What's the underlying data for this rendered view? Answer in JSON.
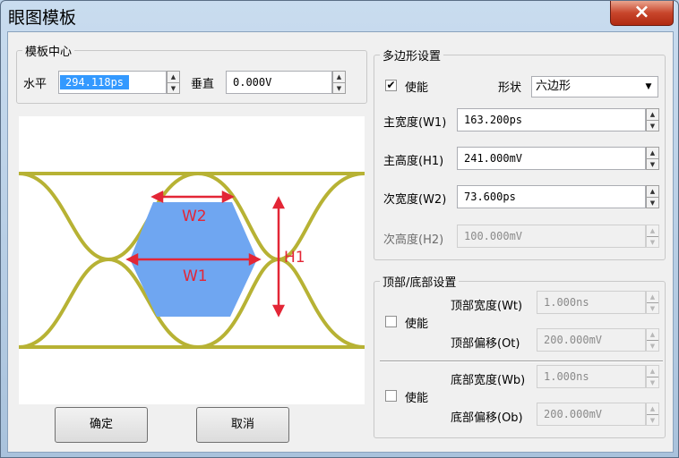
{
  "window": {
    "title": "眼图模板",
    "close_icon": "×"
  },
  "template_center": {
    "legend": "模板中心",
    "horizontal_label": "水平",
    "horizontal_value": "294.118ps",
    "vertical_label": "垂直",
    "vertical_value": "0.000V"
  },
  "diagram": {
    "label_w1": "W1",
    "label_w2": "W2",
    "label_h1": "H1",
    "colors": {
      "eye": "#b7b234",
      "polygon": "#6fa6f1",
      "marker": "#e32636"
    }
  },
  "buttons": {
    "ok": "确定",
    "cancel": "取消"
  },
  "polygon_settings": {
    "legend": "多边形设置",
    "enable_label": "使能",
    "enabled": true,
    "shape_label": "形状",
    "shape_value": "六边形",
    "main_width_label": "主宽度(W1)",
    "main_width_value": "163.200ps",
    "main_height_label": "主高度(H1)",
    "main_height_value": "241.000mV",
    "sub_width_label": "次宽度(W2)",
    "sub_width_value": "73.600ps",
    "sub_height_label": "次高度(H2)",
    "sub_height_value": "100.000mV"
  },
  "top_bottom_settings": {
    "legend": "顶部/底部设置",
    "top_enable_label": "使能",
    "top_width_label": "顶部宽度(Wt)",
    "top_width_value": "1.000ns",
    "top_offset_label": "顶部偏移(Ot)",
    "top_offset_value": "200.000mV",
    "bottom_enable_label": "使能",
    "bottom_width_label": "底部宽度(Wb)",
    "bottom_width_value": "1.000ns",
    "bottom_offset_label": "底部偏移(Ob)",
    "bottom_offset_value": "200.000mV"
  }
}
